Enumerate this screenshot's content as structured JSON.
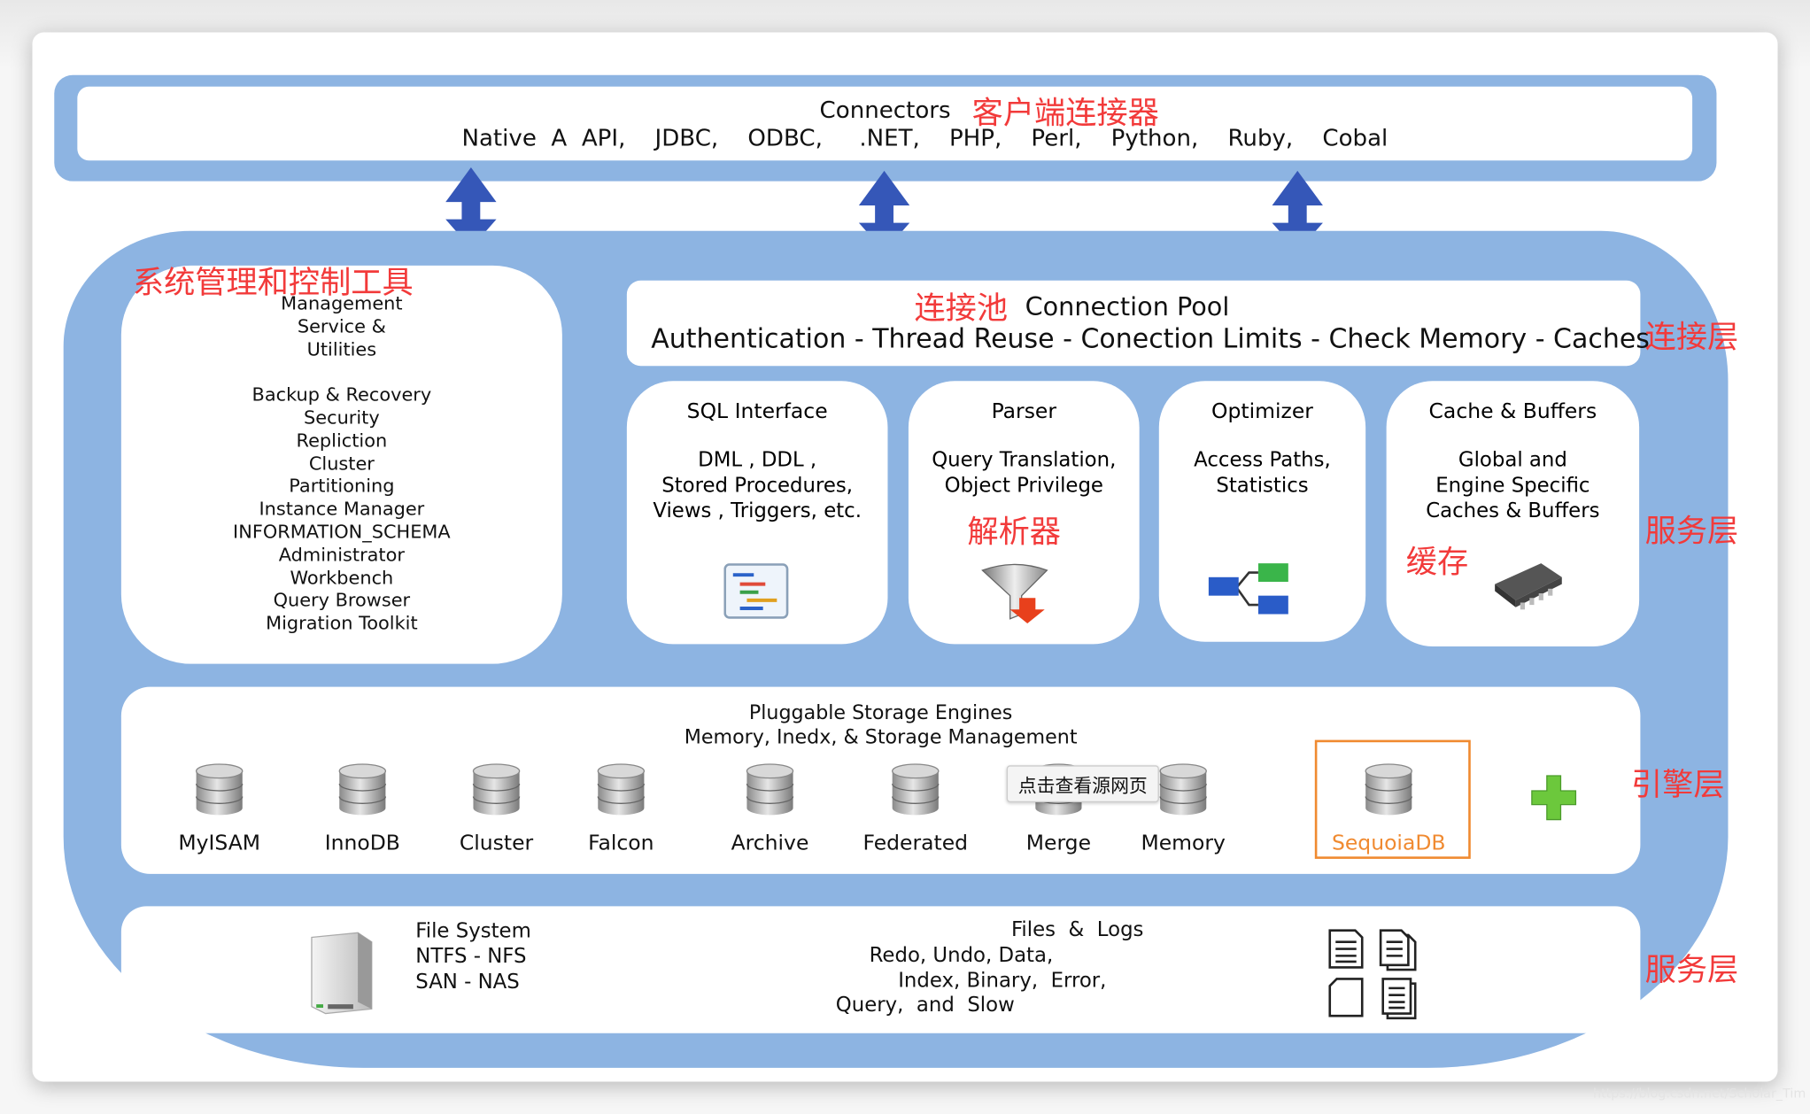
{
  "connectors": {
    "title": "Connectors",
    "title_cn": "客户端连接器",
    "list": "Native  A  API,    JDBC,    ODBC,     .NET,    PHP,    Perl,    Python,    Ruby,    Cobal"
  },
  "management": {
    "title_cn": "系统管理和控制工具",
    "lines": [
      "Management",
      "Service &",
      "Utilities",
      "",
      "Backup & Recovery",
      "Security",
      "Repliction",
      "Cluster",
      "Partitioning",
      "Instance Manager",
      "INFORMATION_SCHEMA",
      "Administrator",
      "Workbench",
      "Query Browser",
      "Migration Toolkit"
    ]
  },
  "connection_pool": {
    "title_cn": "连接池",
    "title": "Connection Pool",
    "items": "Authentication - Thread Reuse - Conection Limits - Check Memory - Caches"
  },
  "layers": {
    "connection": "连接层",
    "service": "服务层",
    "engine": "引擎层",
    "storage": "服务层"
  },
  "services": [
    {
      "title": "SQL Interface",
      "body": [
        "DML , DDL ,",
        "Stored Procedures,",
        "Views , Triggers, etc."
      ],
      "icon": "sql-interface-icon"
    },
    {
      "title": "Parser",
      "body": [
        "Query Translation,",
        "Object Privilege"
      ],
      "label_cn": "解析器",
      "icon": "funnel-icon"
    },
    {
      "title": "Optimizer",
      "body": [
        "Access Paths,",
        "Statistics"
      ],
      "icon": "tree-diagram-icon"
    },
    {
      "title": "Cache & Buffers",
      "body": [
        "Global and",
        "Engine Specific",
        "Caches & Buffers"
      ],
      "label_cn": "缓存",
      "icon": "memory-chip-icon"
    }
  ],
  "storage_engines": {
    "title": "Pluggable Storage Engines",
    "subtitle": "Memory, Inedx, & Storage Management",
    "engines": [
      "MyISAM",
      "InnoDB",
      "Cluster",
      "Falcon",
      "Archive",
      "Federated",
      "Merge",
      "Memory",
      "SequoiaDB"
    ],
    "highlight": "SequoiaDB",
    "highlight_color": "#f08a30",
    "tooltip": "点击查看源网页",
    "add_icon": "green-plus-icon"
  },
  "files": {
    "fs_lines": [
      "File System",
      "NTFS - NFS",
      "SAN - NAS"
    ],
    "logs_title": "Files  &  Logs",
    "logs_lines": [
      "Redo, Undo, Data,",
      "Index, Binary,  Error,",
      "Query,  and  Slow"
    ]
  },
  "watermark": "https://blog.csdn.net/Scholar_Tim",
  "colors": {
    "panel_blue": "#8db4e2",
    "arrow_blue": "#3557b8",
    "annotation_red": "#f23a3a"
  }
}
